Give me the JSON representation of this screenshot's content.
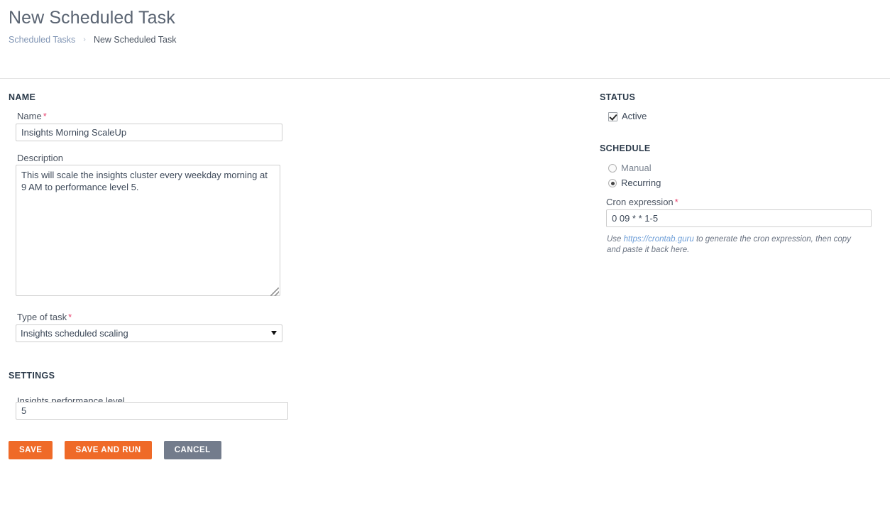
{
  "header": {
    "title": "New Scheduled Task",
    "breadcrumb": {
      "parent": "Scheduled Tasks",
      "separator": "›",
      "current": "New Scheduled Task"
    }
  },
  "left": {
    "name_section": {
      "title": "NAME",
      "name_label": "Name",
      "name_required": "*",
      "name_value": "Insights Morning ScaleUp",
      "description_label": "Description",
      "description_value": "This will scale the insights cluster every weekday morning at 9 AM to performance level 5.",
      "type_label": "Type of task",
      "type_required": "*",
      "type_value": "Insights scheduled scaling",
      "type_options": [
        "Insights scheduled scaling"
      ]
    },
    "settings_section": {
      "title": "SETTINGS",
      "performance_label": "Insights performance level",
      "performance_value": "5"
    },
    "buttons": {
      "save": "SAVE",
      "save_and_run": "SAVE AND RUN",
      "cancel": "CANCEL"
    }
  },
  "right": {
    "status_section": {
      "title": "STATUS",
      "active_label": "Active",
      "active_checked": true
    },
    "schedule_section": {
      "title": "SCHEDULE",
      "manual_label": "Manual",
      "recurring_label": "Recurring",
      "selected": "Recurring",
      "cron_label": "Cron expression",
      "cron_required": "*",
      "cron_value": "0 09 * * 1-5",
      "help_prefix": "Use ",
      "help_link": "https://crontab.guru",
      "help_suffix": " to generate the cron expression, then copy and paste it back here."
    }
  },
  "colors": {
    "accent_orange": "#ef6a28",
    "cancel_gray": "#737c8c",
    "required_pink": "#e8436f",
    "link_blue": "#6f9fd8",
    "breadcrumb_blue": "#8296b5"
  }
}
